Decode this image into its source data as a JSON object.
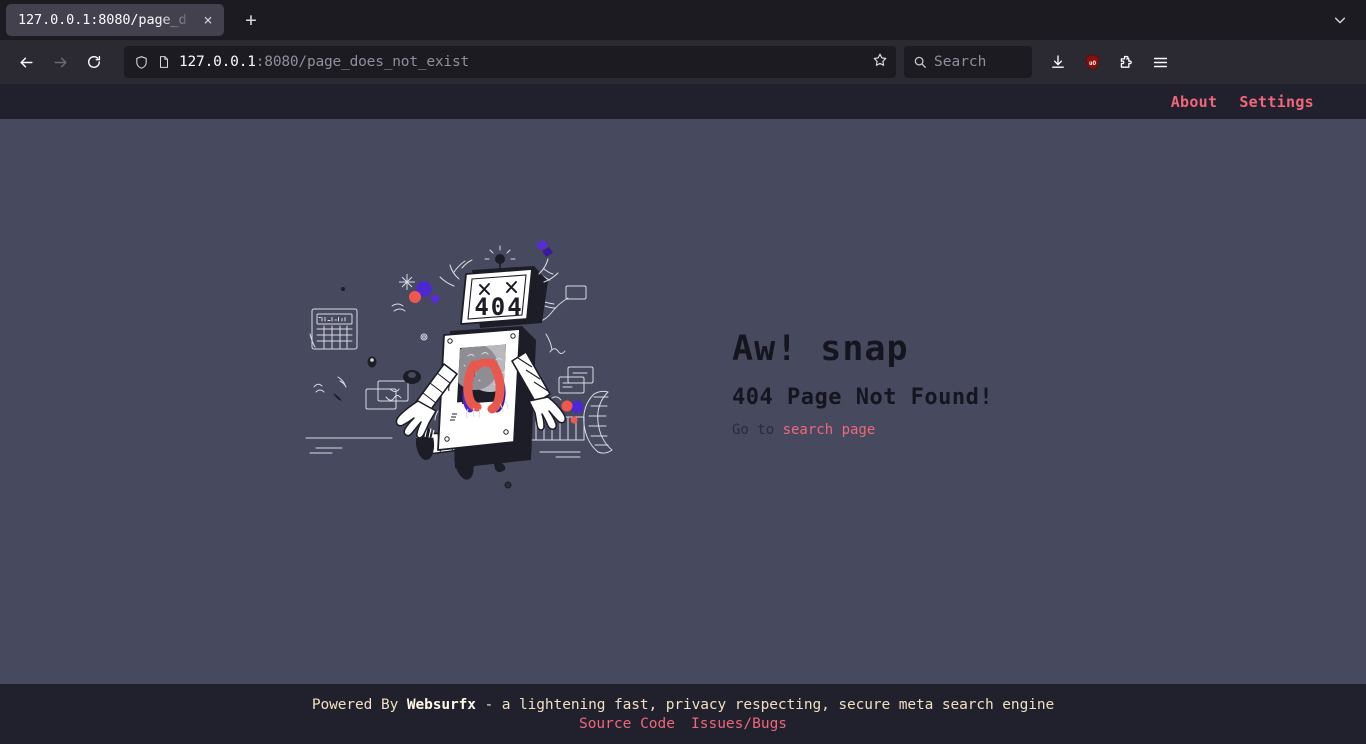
{
  "browser": {
    "tab": {
      "title": "127.0.0.1:8080/page_d",
      "close_label": "×"
    },
    "newtab_label": "+",
    "toolbar": {
      "back_icon": "back-arrow-icon",
      "forward_icon": "forward-arrow-icon",
      "reload_icon": "reload-icon",
      "shield_icon": "tracking-protection-shield-icon",
      "page_icon": "page-document-icon",
      "url_host": "127.0.0.1",
      "url_rest": ":8080/page_does_not_exist",
      "bookmark_icon": "star-icon",
      "search_placeholder": "Search",
      "downloads_icon": "download-icon",
      "ublock_icon": "ublock-origin-shield-icon",
      "ublock_label": "uO",
      "extensions_icon": "extensions-puzzle-icon",
      "menu_icon": "hamburger-menu-icon",
      "tablist_icon": "chevron-down-icon"
    }
  },
  "site": {
    "nav": [
      {
        "label": "About"
      },
      {
        "label": "Settings"
      }
    ],
    "error": {
      "heading": "Aw! snap",
      "subheading": "404 Page Not Found!",
      "hint_prefix": "Go to ",
      "hint_link": "search page"
    },
    "illustration": {
      "name": "broken-robot-404-illustration",
      "screen_text": "404"
    },
    "footer": {
      "powered_prefix": "Powered By ",
      "brand": "Websurfx",
      "tagline": " - a lightening fast, privacy respecting, secure meta search engine",
      "links": [
        {
          "label": "Source Code"
        },
        {
          "label": "Issues/Bugs"
        }
      ]
    }
  },
  "colors": {
    "chrome_tabstrip": "#1c1b22",
    "chrome_navbar": "#2b2a33",
    "site_nav_bg": "#21212e",
    "page_bg": "#474a5e",
    "accent_pink": "#f0667a",
    "footer_text": "#f0dfc0"
  }
}
